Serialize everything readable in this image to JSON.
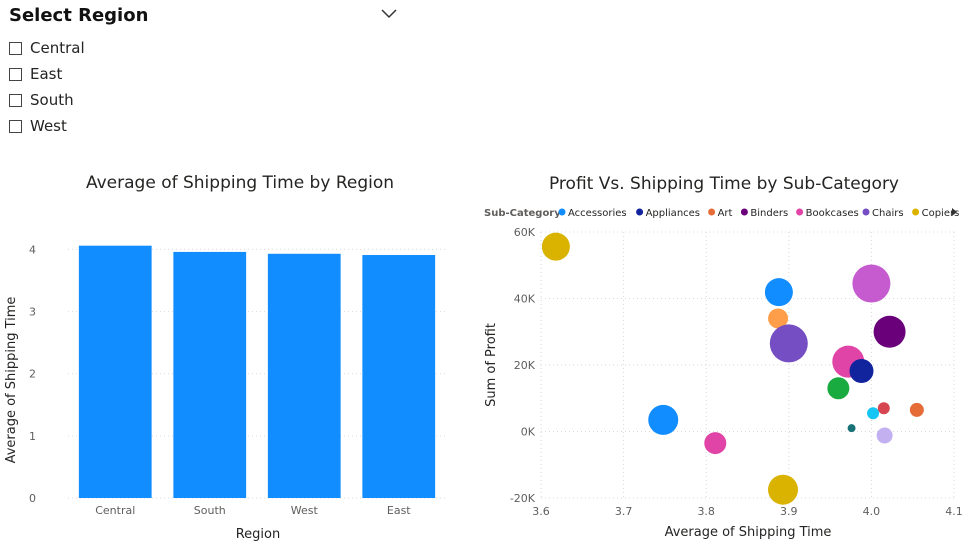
{
  "slicer": {
    "title": "Select Region",
    "options": [
      {
        "label": "Central",
        "checked": false
      },
      {
        "label": "East",
        "checked": false
      },
      {
        "label": "South",
        "checked": false
      },
      {
        "label": "West",
        "checked": false
      }
    ]
  },
  "colors": {
    "bar": "#118DFF",
    "grid": "#d9d9d9"
  },
  "chart_data": [
    {
      "type": "bar",
      "title": "Average of Shipping Time by Region",
      "xlabel": "Region",
      "ylabel": "Average of Shipping Time",
      "categories": [
        "Central",
        "South",
        "West",
        "East"
      ],
      "values": [
        4.06,
        3.96,
        3.93,
        3.91
      ],
      "ylim": [
        0,
        4.2
      ],
      "yticks": [
        0,
        1,
        2,
        3,
        4
      ],
      "grid": true
    },
    {
      "type": "scatter",
      "title": "Profit Vs. Shipping Time by Sub-Category",
      "xlabel": "Average of Shipping Time",
      "ylabel": "Sum of Profit",
      "xlim": [
        3.6,
        4.1
      ],
      "ylim": [
        -20000,
        60000
      ],
      "xticks": [
        "3.6",
        "3.7",
        "3.8",
        "3.9",
        "4.0",
        "4.1"
      ],
      "xtick_values": [
        3.6,
        3.7,
        3.8,
        3.9,
        4.0,
        4.1
      ],
      "yticks": [
        "-20K",
        "0K",
        "20K",
        "40K",
        "60K"
      ],
      "ytick_values": [
        -20000,
        0,
        20000,
        40000,
        60000
      ],
      "grid": true,
      "legend": {
        "title": "Sub-Category",
        "position": "top",
        "items": [
          {
            "name": "Accessories",
            "color": "#118DFF"
          },
          {
            "name": "Appliances",
            "color": "#12239E"
          },
          {
            "name": "Art",
            "color": "#E66C37"
          },
          {
            "name": "Binders",
            "color": "#6B007B"
          },
          {
            "name": "Bookcases",
            "color": "#E044A7"
          },
          {
            "name": "Chairs",
            "color": "#744EC2"
          },
          {
            "name": "Copiers",
            "color": "#D9B300"
          }
        ]
      },
      "points": [
        {
          "x": 3.618,
          "y": 55600,
          "size": 14,
          "color": "#D9B300"
        },
        {
          "x": 3.888,
          "y": 41900,
          "size": 14,
          "color": "#118DFF"
        },
        {
          "x": 3.887,
          "y": 34000,
          "size": 10,
          "color": "#FF9E4A"
        },
        {
          "x": 3.9,
          "y": 26500,
          "size": 19,
          "color": "#744EC2"
        },
        {
          "x": 4.0,
          "y": 44500,
          "size": 19,
          "color": "#C55BCF"
        },
        {
          "x": 4.022,
          "y": 30000,
          "size": 16,
          "color": "#6B007B"
        },
        {
          "x": 3.972,
          "y": 21000,
          "size": 16,
          "color": "#E044A7"
        },
        {
          "x": 3.988,
          "y": 18200,
          "size": 12,
          "color": "#12239E"
        },
        {
          "x": 3.96,
          "y": 13000,
          "size": 11,
          "color": "#1AAB40"
        },
        {
          "x": 4.015,
          "y": 7000,
          "size": 6,
          "color": "#D64550"
        },
        {
          "x": 4.055,
          "y": 6500,
          "size": 7,
          "color": "#E66C37"
        },
        {
          "x": 4.002,
          "y": 5500,
          "size": 6,
          "color": "#15C6F4"
        },
        {
          "x": 3.976,
          "y": 1000,
          "size": 4,
          "color": "#197278"
        },
        {
          "x": 4.016,
          "y": -1200,
          "size": 8,
          "color": "#C3B0F0"
        },
        {
          "x": 3.748,
          "y": 3500,
          "size": 15,
          "color": "#118DFF"
        },
        {
          "x": 3.811,
          "y": -3500,
          "size": 11,
          "color": "#E044A7"
        },
        {
          "x": 3.893,
          "y": -17500,
          "size": 15,
          "color": "#D9B300"
        }
      ]
    }
  ]
}
